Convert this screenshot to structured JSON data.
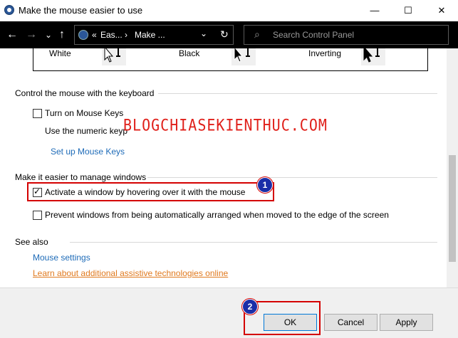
{
  "window": {
    "title": "Make the mouse easier to use",
    "minimize": "—",
    "maximize": "☐",
    "close": "✕"
  },
  "nav": {
    "back": "←",
    "forward": "→",
    "recent": "⌄",
    "up": "↑",
    "breadcrumb_overflow": "«",
    "crumb1": "Eas...",
    "sep": "›",
    "crumb2": "Make ...",
    "dropdown": "⌄",
    "refresh": "↻",
    "search_placeholder": "Search Control Panel",
    "search_glyph": "⌕"
  },
  "pointer_schemes": [
    {
      "label": "White"
    },
    {
      "label": "Black"
    },
    {
      "label": "Inverting"
    }
  ],
  "keyboard_section": {
    "heading": "Control the mouse with the keyboard",
    "mouse_keys_label": "Turn on Mouse Keys",
    "mouse_keys_checked": false,
    "description": "Use the numeric keyp",
    "setup_link": "Set up Mouse Keys"
  },
  "windows_section": {
    "heading": "Make it easier to manage windows",
    "hover_label": "Activate a window by hovering over it with the mouse",
    "hover_checked": true,
    "arrange_label": "Prevent windows from being automatically arranged when moved to the edge of the screen",
    "arrange_checked": false
  },
  "see_also": {
    "heading": "See also",
    "mouse_settings": "Mouse settings",
    "assistive_link": "Learn about additional assistive technologies online"
  },
  "watermark": "BLOGCHIASEKIENTHUC.COM",
  "annotations": {
    "badge1": "1",
    "badge2": "2"
  },
  "buttons": {
    "ok": "OK",
    "cancel": "Cancel",
    "apply": "Apply"
  },
  "colors": {
    "highlight": "#d40000",
    "badge": "#1a2ea8",
    "link": "#1e6bb8",
    "link_orange": "#e07a1f",
    "watermark": "#e0201a"
  }
}
